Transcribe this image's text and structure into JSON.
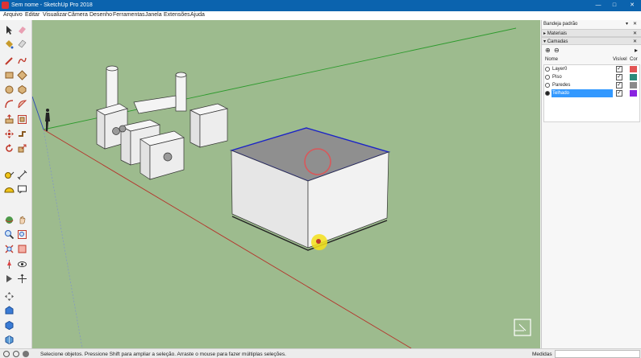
{
  "window": {
    "title": "Sem nome - SketchUp Pro 2018"
  },
  "menu": [
    "Arquivo",
    "Editar",
    "Visualizar",
    "Câmera",
    "Desenho",
    "Ferramentas",
    "Janela",
    "Extensões",
    "Ajuda"
  ],
  "toolbar": {
    "tools": [
      "select-arrow-icon",
      "eraser-icon",
      "paint-bucket-icon",
      "eraser-alt-icon",
      "line-pencil-icon",
      "freehand-icon",
      "rectangle-icon",
      "rotated-rectangle-icon",
      "circle-icon",
      "polygon-icon",
      "arc-icon",
      "pie-arc-icon",
      "push-pull-icon",
      "offset-icon",
      "move-icon",
      "follow-me-icon",
      "rotate-icon",
      "scale-icon",
      "tape-measure-icon",
      "dimension-icon",
      "protractor-icon",
      "text-icon",
      "orbit-icon",
      "pan-icon",
      "zoom-icon",
      "zoom-window-icon",
      "zoom-extents-icon",
      "section-plane-icon",
      "walk-icon",
      "look-around-icon",
      "position-camera-icon",
      "axes-icon",
      "sandbox-icon",
      "warehouse-icon",
      "extension-icon",
      "layout-icon"
    ]
  },
  "tray": {
    "title": "Bandeja padrão",
    "panels": {
      "materials": "Materiais",
      "layers": "Camadas"
    },
    "layers": {
      "headers": {
        "name": "Nome",
        "visible": "Visível",
        "color": "Cor"
      },
      "rows": [
        {
          "name": "Layer0",
          "visible": true,
          "color": "#e25454",
          "active": false
        },
        {
          "name": "Piso",
          "visible": true,
          "color": "#2b8a7a",
          "active": false
        },
        {
          "name": "Paredes",
          "visible": true,
          "color": "#8a8a8a",
          "active": false
        },
        {
          "name": "Telhado",
          "visible": true,
          "color": "#8a23e0",
          "active": true
        }
      ]
    }
  },
  "status": {
    "hint": "Selecione objetos. Pressione Shift para ampliar a seleção. Arraste o mouse para fazer múltiplas seleções.",
    "measurements_label": "Medidas"
  },
  "colors": {
    "sky": "#9dbb8e",
    "selection": "#1a22c8",
    "accent_highlight": "#f5e11b",
    "title_bar": "#0b63ae"
  }
}
